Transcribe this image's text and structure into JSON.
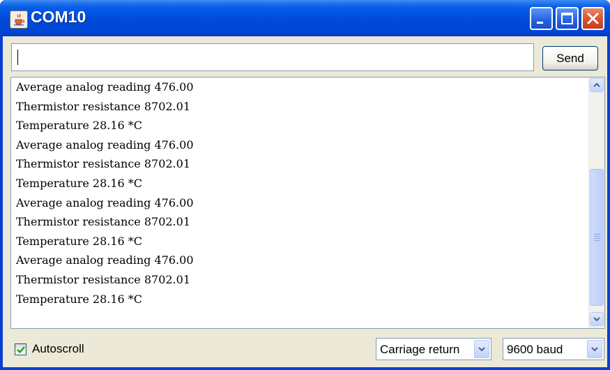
{
  "window": {
    "title": "COM10",
    "icon": "java-cup-icon",
    "controls": [
      "minimize-icon",
      "maximize-icon",
      "close-icon"
    ]
  },
  "input": {
    "value": "",
    "send_label": "Send"
  },
  "output": {
    "lines": [
      "Average analog reading 476.00",
      "Thermistor resistance 8702.01",
      "Temperature 28.16 *C",
      "Average analog reading 476.00",
      "Thermistor resistance 8702.01",
      "Temperature 28.16 *C",
      "Average analog reading 476.00",
      "Thermistor resistance 8702.01",
      "Temperature 28.16 *C",
      "Average analog reading 476.00",
      "Thermistor resistance 8702.01",
      "Temperature 28.16 *C"
    ]
  },
  "status": {
    "autoscroll_label": "Autoscroll",
    "autoscroll_checked": true,
    "line_ending": "Carriage return",
    "baud_rate": "9600 baud"
  },
  "colors": {
    "title_bar": "#0054e3",
    "close_button": "#d9512b",
    "window_bg": "#ece9d8"
  }
}
